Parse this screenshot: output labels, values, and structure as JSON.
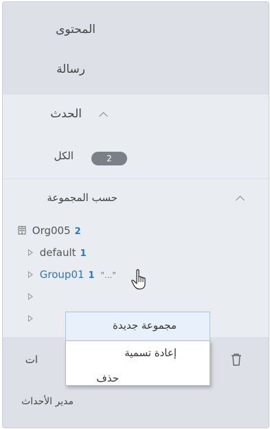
{
  "nav": {
    "content": "المحتوى",
    "message": "رسالة",
    "event": "الحدث",
    "all_label": "الكل",
    "all_count": "2",
    "by_group": "حسب المجموعة",
    "org": {
      "name": "Org005",
      "count": "2"
    },
    "groups": [
      {
        "name": "default",
        "count": "1"
      },
      {
        "name": "Group01",
        "count": "1"
      }
    ],
    "partial_label": "ات",
    "event_manager": "مدير الأحداث"
  },
  "context_menu": {
    "items": [
      "مجموعة جديدة",
      "إعادة تسمية",
      "حذف"
    ]
  },
  "colors": {
    "accent": "#2b77c5",
    "panel": "#dde1e7",
    "section_bg": "#e9ecf0"
  }
}
